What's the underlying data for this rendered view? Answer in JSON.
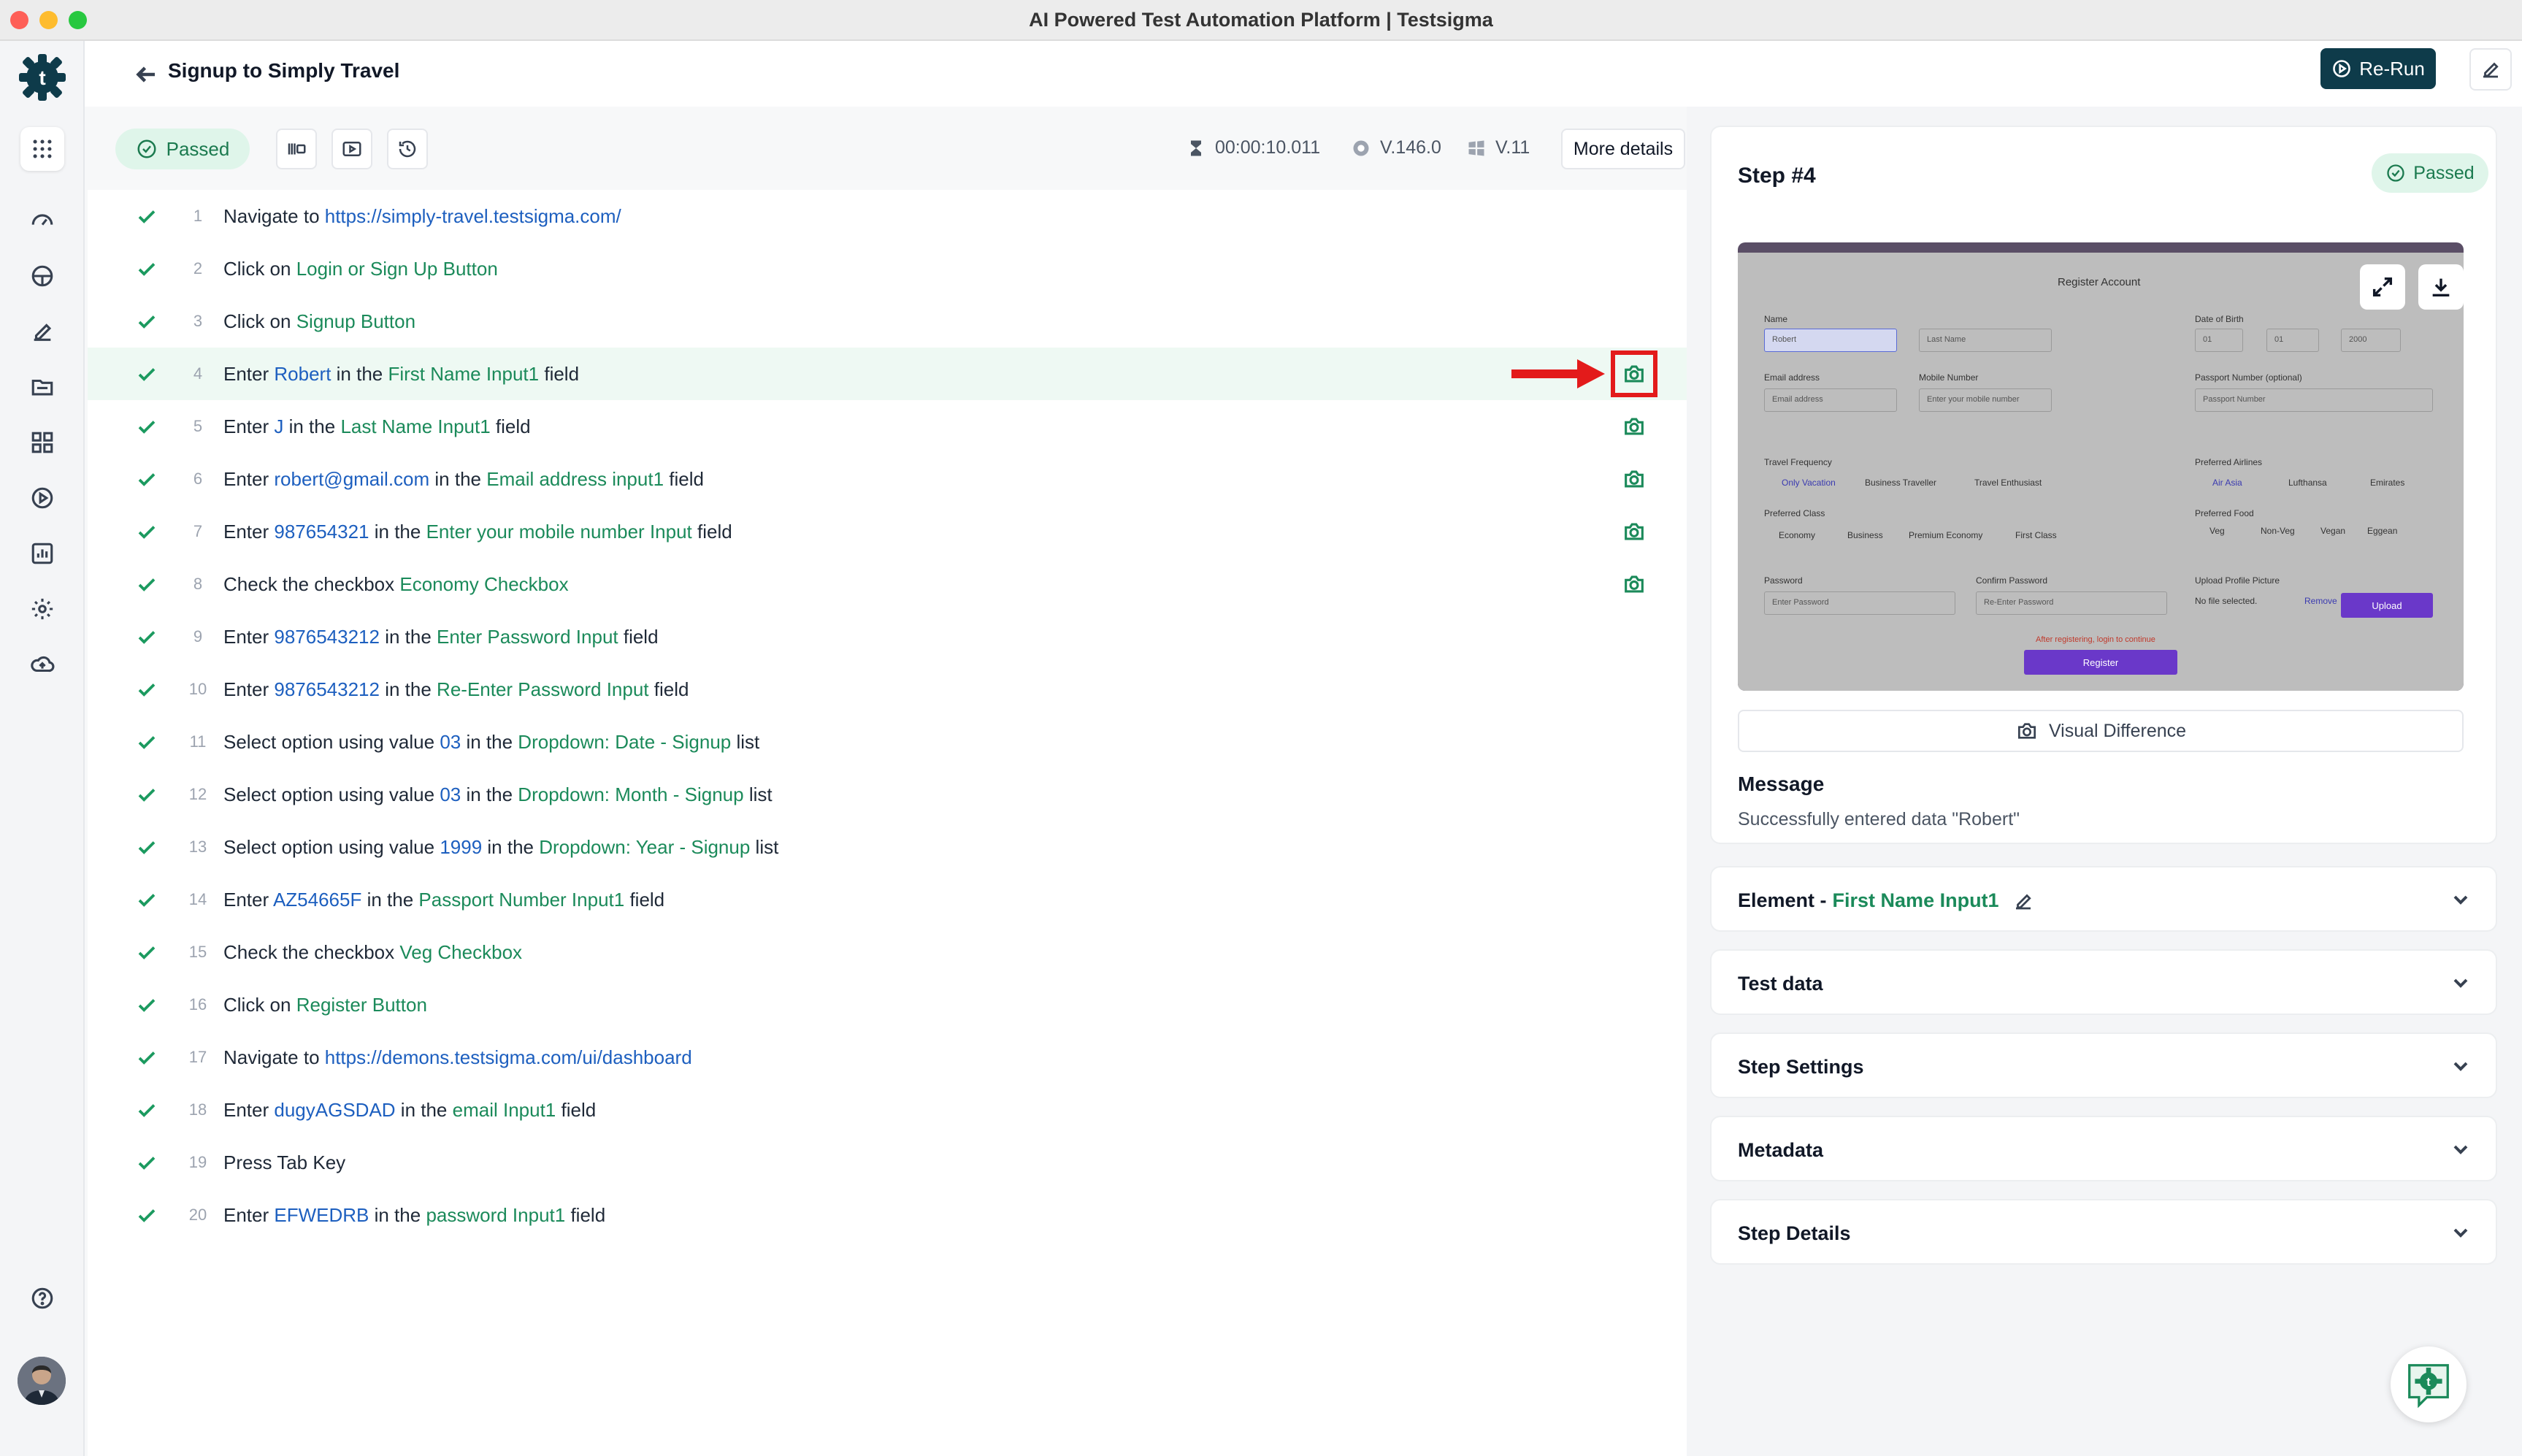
{
  "window": {
    "title": "AI Powered Test Automation Platform | Testsigma"
  },
  "sidebar": {
    "items": [
      {
        "name": "apps-icon"
      },
      {
        "name": "dashboard-icon"
      },
      {
        "name": "steering-icon"
      },
      {
        "name": "edit-icon"
      },
      {
        "name": "folder-icon"
      },
      {
        "name": "grid-icon"
      },
      {
        "name": "run-icon"
      },
      {
        "name": "reports-icon"
      },
      {
        "name": "settings-icon"
      },
      {
        "name": "cloud-upload-icon"
      }
    ]
  },
  "header": {
    "title": "Signup to Simply Travel",
    "rerun_label": "Re-Run"
  },
  "toolbar": {
    "status": "Passed",
    "duration": "00:00:10.011",
    "browser_version": "V.146.0",
    "os_version": "V.11",
    "more_details": "More details"
  },
  "steps": [
    {
      "num": "1",
      "parts": [
        [
          "t",
          "Navigate to "
        ],
        [
          "d",
          "https://simply-travel.testsigma.com/"
        ]
      ],
      "cam": false
    },
    {
      "num": "2",
      "parts": [
        [
          "t",
          "Click on "
        ],
        [
          "e",
          "Login or Sign Up Button"
        ]
      ],
      "cam": false
    },
    {
      "num": "3",
      "parts": [
        [
          "t",
          "Click on "
        ],
        [
          "e",
          "Signup Button"
        ]
      ],
      "cam": false
    },
    {
      "num": "4",
      "parts": [
        [
          "t",
          "Enter "
        ],
        [
          "d",
          "Robert"
        ],
        [
          "t",
          " in the "
        ],
        [
          "e",
          "First Name Input1"
        ],
        [
          "t",
          " field"
        ]
      ],
      "cam": true
    },
    {
      "num": "5",
      "parts": [
        [
          "t",
          "Enter "
        ],
        [
          "d",
          "J"
        ],
        [
          "t",
          " in the "
        ],
        [
          "e",
          "Last Name Input1"
        ],
        [
          "t",
          " field"
        ]
      ],
      "cam": true
    },
    {
      "num": "6",
      "parts": [
        [
          "t",
          "Enter "
        ],
        [
          "d",
          "robert@gmail.com"
        ],
        [
          "t",
          " in the "
        ],
        [
          "e",
          "Email address input1"
        ],
        [
          "t",
          " field"
        ]
      ],
      "cam": true
    },
    {
      "num": "7",
      "parts": [
        [
          "t",
          "Enter "
        ],
        [
          "d",
          "987654321"
        ],
        [
          "t",
          " in the "
        ],
        [
          "e",
          "Enter your mobile number Input"
        ],
        [
          "t",
          " field"
        ]
      ],
      "cam": true
    },
    {
      "num": "8",
      "parts": [
        [
          "t",
          "Check the checkbox "
        ],
        [
          "e",
          "Economy Checkbox"
        ]
      ],
      "cam": true
    },
    {
      "num": "9",
      "parts": [
        [
          "t",
          "Enter "
        ],
        [
          "d",
          "9876543212"
        ],
        [
          "t",
          " in the "
        ],
        [
          "e",
          "Enter Password Input"
        ],
        [
          "t",
          " field"
        ]
      ],
      "cam": false
    },
    {
      "num": "10",
      "parts": [
        [
          "t",
          "Enter "
        ],
        [
          "d",
          "9876543212"
        ],
        [
          "t",
          " in the "
        ],
        [
          "e",
          "Re-Enter Password Input"
        ],
        [
          "t",
          " field"
        ]
      ],
      "cam": false
    },
    {
      "num": "11",
      "parts": [
        [
          "t",
          "Select option using value "
        ],
        [
          "d",
          "03"
        ],
        [
          "t",
          " in the "
        ],
        [
          "e",
          "Dropdown: Date - Signup"
        ],
        [
          "t",
          " list"
        ]
      ],
      "cam": false
    },
    {
      "num": "12",
      "parts": [
        [
          "t",
          "Select option using value "
        ],
        [
          "d",
          "03"
        ],
        [
          "t",
          " in the "
        ],
        [
          "e",
          "Dropdown: Month - Signup"
        ],
        [
          "t",
          " list"
        ]
      ],
      "cam": false
    },
    {
      "num": "13",
      "parts": [
        [
          "t",
          "Select option using value "
        ],
        [
          "d",
          "1999"
        ],
        [
          "t",
          " in the "
        ],
        [
          "e",
          "Dropdown: Year - Signup"
        ],
        [
          "t",
          " list"
        ]
      ],
      "cam": false
    },
    {
      "num": "14",
      "parts": [
        [
          "t",
          "Enter "
        ],
        [
          "d",
          "AZ54665F"
        ],
        [
          "t",
          " in the "
        ],
        [
          "e",
          "Passport Number Input1"
        ],
        [
          "t",
          " field"
        ]
      ],
      "cam": false
    },
    {
      "num": "15",
      "parts": [
        [
          "t",
          "Check the checkbox "
        ],
        [
          "e",
          "Veg Checkbox"
        ]
      ],
      "cam": false
    },
    {
      "num": "16",
      "parts": [
        [
          "t",
          "Click on "
        ],
        [
          "e",
          "Register Button"
        ]
      ],
      "cam": false
    },
    {
      "num": "17",
      "parts": [
        [
          "t",
          "Navigate to "
        ],
        [
          "d",
          "https://demons.testsigma.com/ui/dashboard"
        ]
      ],
      "cam": false
    },
    {
      "num": "18",
      "parts": [
        [
          "t",
          "Enter "
        ],
        [
          "d",
          "dugyAGSDAD"
        ],
        [
          "t",
          " in the "
        ],
        [
          "e",
          "email Input1"
        ],
        [
          "t",
          " field"
        ]
      ],
      "cam": false
    },
    {
      "num": "19",
      "parts": [
        [
          "t",
          "Press Tab Key"
        ]
      ],
      "cam": false
    },
    {
      "num": "20",
      "parts": [
        [
          "t",
          "Enter "
        ],
        [
          "d",
          "EFWEDRB"
        ],
        [
          "t",
          " in the "
        ],
        [
          "e",
          "password Input1"
        ],
        [
          "t",
          " field"
        ]
      ],
      "cam": false
    }
  ],
  "step_panel": {
    "title": "Step #4",
    "status": "Passed",
    "visual_difference": "Visual Difference",
    "message_label": "Message",
    "message": "Successfully entered data \"Robert\"",
    "element_prefix": "Element - ",
    "element_name": "First Name Input1",
    "accordions": [
      "Test data",
      "Step Settings",
      "Metadata",
      "Step Details"
    ]
  },
  "screenshot_form": {
    "title": "Register Account",
    "name_label": "Name",
    "first_value": "Robert",
    "last_placeholder": "Last Name",
    "dob_label": "Date of Birth",
    "dob_day": "01",
    "dob_month": "01",
    "dob_year": "2000",
    "email_label": "Email address",
    "email_placeholder": "Email address",
    "mobile_label": "Mobile Number",
    "mobile_placeholder": "Enter your mobile number",
    "passport_label": "Passport Number (optional)",
    "passport_placeholder": "Passport Number",
    "freq_label": "Travel Frequency",
    "freq_opts": [
      "Only Vacation",
      "Business Traveller",
      "Travel Enthusiast"
    ],
    "airline_label": "Preferred Airlines",
    "airline_opts": [
      "Air Asia",
      "Lufthansa",
      "Emirates"
    ],
    "class_label": "Preferred Class",
    "class_opts": [
      "Economy",
      "Business",
      "Premium Economy",
      "First Class"
    ],
    "food_label": "Preferred Food",
    "food_opts": [
      "Veg",
      "Non-Veg",
      "Vegan",
      "Eggean"
    ],
    "password_label": "Password",
    "password_placeholder": "Enter Password",
    "confirm_label": "Confirm Password",
    "confirm_placeholder": "Re-Enter Password",
    "upload_label": "Upload Profile Picture",
    "no_file": "No file selected.",
    "remove": "Remove",
    "upload_btn": "Upload",
    "note": "After registering, login to continue",
    "register_btn": "Register"
  },
  "colors": {
    "accent": "#1b8a5a",
    "data": "#1d5fbf",
    "primary": "#0e3b4a",
    "highlight": "#e31b1b"
  }
}
